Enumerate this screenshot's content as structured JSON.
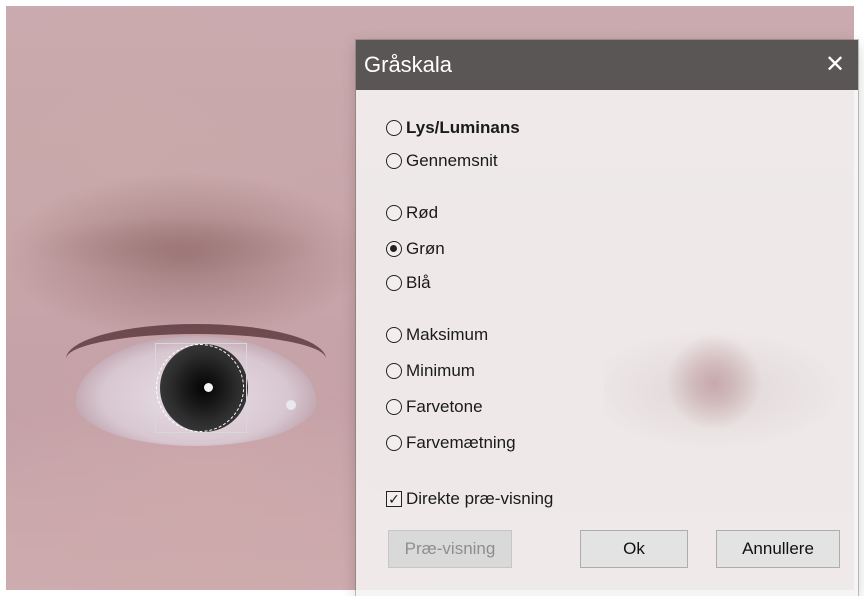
{
  "dialog": {
    "title": "Gråskala",
    "close_icon": "close-icon",
    "options": [
      {
        "label": "Lys/Luminans",
        "checked": false,
        "bold": true
      },
      {
        "label": "Gennemsnit",
        "checked": false
      },
      {
        "label": "Rød",
        "checked": false
      },
      {
        "label": "Grøn",
        "checked": true
      },
      {
        "label": "Blå",
        "checked": false
      },
      {
        "label": "Maksimum",
        "checked": false
      },
      {
        "label": "Minimum",
        "checked": false
      },
      {
        "label": "Farvetone",
        "checked": false
      },
      {
        "label": "Farvemætning",
        "checked": false
      }
    ],
    "direct_preview": {
      "label": "Direkte præ-visning",
      "checked": true
    },
    "buttons": {
      "preview": "Præ-visning",
      "ok": "Ok",
      "cancel": "Annullere"
    }
  },
  "colors": {
    "titlebar": "#5a5656",
    "dialog_bg": "#f4f3f3",
    "button_bg": "#e3e3e3"
  }
}
